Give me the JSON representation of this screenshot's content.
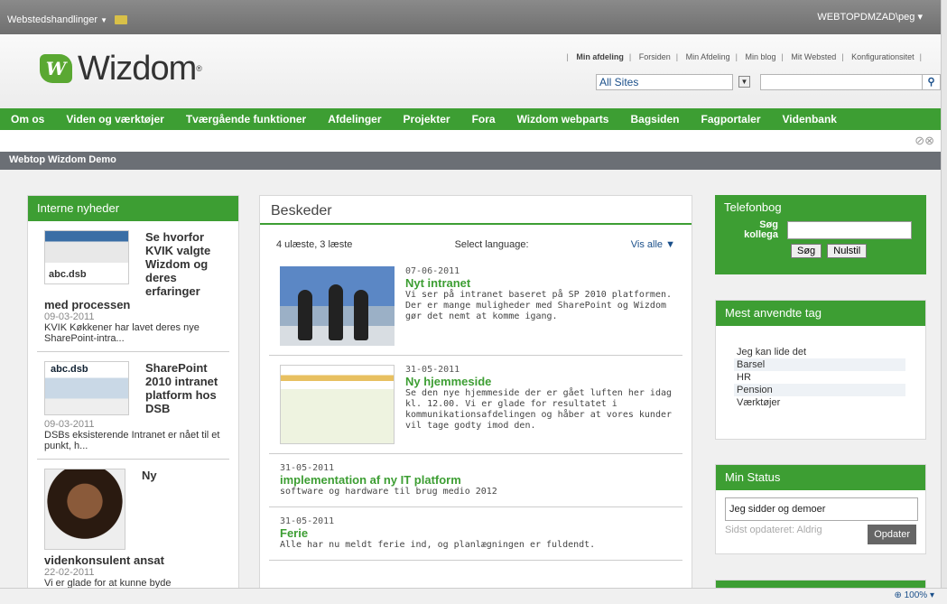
{
  "topbar": {
    "site_actions": "Webstedshandlinger",
    "user": "WEBTOPDMZAD\\peg"
  },
  "logo": {
    "name": "Wizdom"
  },
  "toplinks": [
    {
      "label": "Min afdeling",
      "bold": true
    },
    {
      "label": "Forsiden"
    },
    {
      "label": "Min Afdeling"
    },
    {
      "label": "Min blog"
    },
    {
      "label": "Mit Websted"
    },
    {
      "label": "Konfigurationsitet"
    }
  ],
  "search": {
    "scope": "All Sites",
    "placeholder": ""
  },
  "nav": [
    "Om os",
    "Viden og værktøjer",
    "Tværgående funktioner",
    "Afdelinger",
    "Projekter",
    "Fora",
    "Wizdom webparts",
    "Bagsiden",
    "Fagportaler",
    "Videnbank"
  ],
  "breadcrumb": "Webtop Wizdom Demo",
  "news": {
    "title": "Interne nyheder",
    "items": [
      {
        "title": "Se hvorfor KVIK valgte Wizdom og deres erfaringer med processen",
        "date": "09-03-2011",
        "summary": "KVIK Køkkener har lavet deres nye SharePoint-intra...",
        "thumb_label": "abc.dsb"
      },
      {
        "title": "SharePoint 2010 intranet platform hos DSB",
        "date": "09-03-2011",
        "summary": "DSBs eksisterende Intranet er nået til et punkt, h...",
        "thumb_label": "abc.dsb"
      },
      {
        "title": "Ny videnkonsulent ansat",
        "date": "22-02-2011",
        "summary": "Vi er glade for at kunne byde velkommen til Trine..."
      }
    ]
  },
  "messages": {
    "title": "Beskeder",
    "counts": "4 ulæste, 3 læste",
    "language_label": "Select language:",
    "view_all": "Vis alle",
    "items": [
      {
        "date": "07-06-2011",
        "title": "Nyt intranet",
        "text": "Vi ser på intranet baseret på SP 2010 platformen. Der er mange muligheder med SharePoint og Wizdom gør det nemt at komme igang."
      },
      {
        "date": "31-05-2011",
        "title": "Ny hjemmeside",
        "text": "Se den nye hjemmeside der er gået luften her idag kl. 12.00. Vi er glade for resultatet i kommunikationsafdelingen og håber at vores kunder vil tage godty imod den."
      },
      {
        "date": "31-05-2011",
        "title": "implementation af ny IT platform",
        "text": "software og hardware til brug medio 2012"
      },
      {
        "date": "31-05-2011",
        "title": "Ferie",
        "text": "Alle har nu meldt ferie ind, og planlægningen er fuldendt."
      }
    ]
  },
  "phonebook": {
    "title": "Telefonbog",
    "label": "Søg kollega",
    "search_btn": "Søg",
    "reset_btn": "Nulstil"
  },
  "tags": {
    "title": "Mest anvendte tag",
    "items": [
      "Jeg kan lide det",
      "Barsel",
      "HR",
      "Pension",
      "Værktøjer"
    ]
  },
  "status": {
    "title": "Min Status",
    "value": "Jeg sidder og demoer",
    "updated": "Sidst opdateret: Aldrig",
    "button": "Opdater"
  },
  "zoom": "100%"
}
